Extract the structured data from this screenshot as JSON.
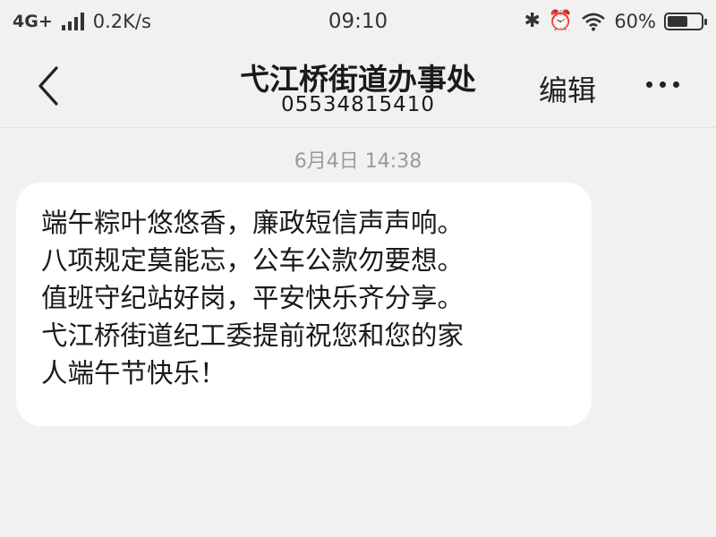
{
  "status_bar": {
    "network": "4G+",
    "speed": "0.2K/s",
    "time": "09:10",
    "bluetooth_icon": "✱",
    "alarm_icon": "⏰",
    "battery_percent": "60%",
    "battery_level": 0.6
  },
  "header": {
    "contact_name": "弋江桥街道办事处",
    "contact_number": "05534815410",
    "edit_label": "编辑"
  },
  "message": {
    "timestamp": "6月4日 14:38",
    "lines": [
      "端午粽叶悠悠香，廉政短信声声响。",
      "八项规定莫能忘，公车公款勿要想。",
      "值班守纪站好岗，平安快乐齐分享。",
      "弋江桥街道纪工委提前祝您和您的家",
      "人端午节快乐！"
    ]
  }
}
